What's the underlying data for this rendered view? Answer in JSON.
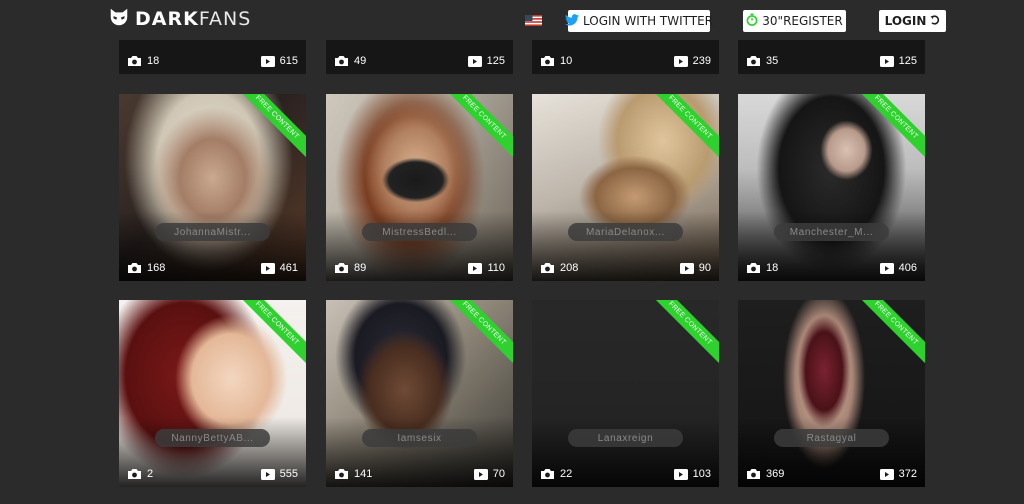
{
  "header": {
    "brand_dark": "DARK",
    "brand_fans": "FANS",
    "login_twitter_label": "LOGIN WITH TWITTER",
    "register_label": "30\"REGISTER",
    "login_label": "LOGIN"
  },
  "free_badge": "FREE CONTENT",
  "top_row": [
    {
      "photos": "18",
      "videos": "615"
    },
    {
      "photos": "49",
      "videos": "125"
    },
    {
      "photos": "10",
      "videos": "239"
    },
    {
      "photos": "35",
      "videos": "125"
    }
  ],
  "row2": [
    {
      "name": "JohannaMistr...",
      "photos": "168",
      "videos": "461"
    },
    {
      "name": "MistressBedl...",
      "photos": "89",
      "videos": "110"
    },
    {
      "name": "MariaDelanox...",
      "photos": "208",
      "videos": "90"
    },
    {
      "name": "Manchester_M...",
      "photos": "18",
      "videos": "406"
    }
  ],
  "row3": [
    {
      "name": "NannyBettyAB...",
      "photos": "2",
      "videos": "555"
    },
    {
      "name": "Iamsesix",
      "photos": "141",
      "videos": "70"
    },
    {
      "name": "Lanaxreign",
      "photos": "22",
      "videos": "103"
    },
    {
      "name": "Rastagyal",
      "photos": "369",
      "videos": "372"
    }
  ],
  "colors": {
    "accent_green": "#2fd12f",
    "background": "#2b2b2b",
    "twitter_blue": "#1da1f2"
  }
}
